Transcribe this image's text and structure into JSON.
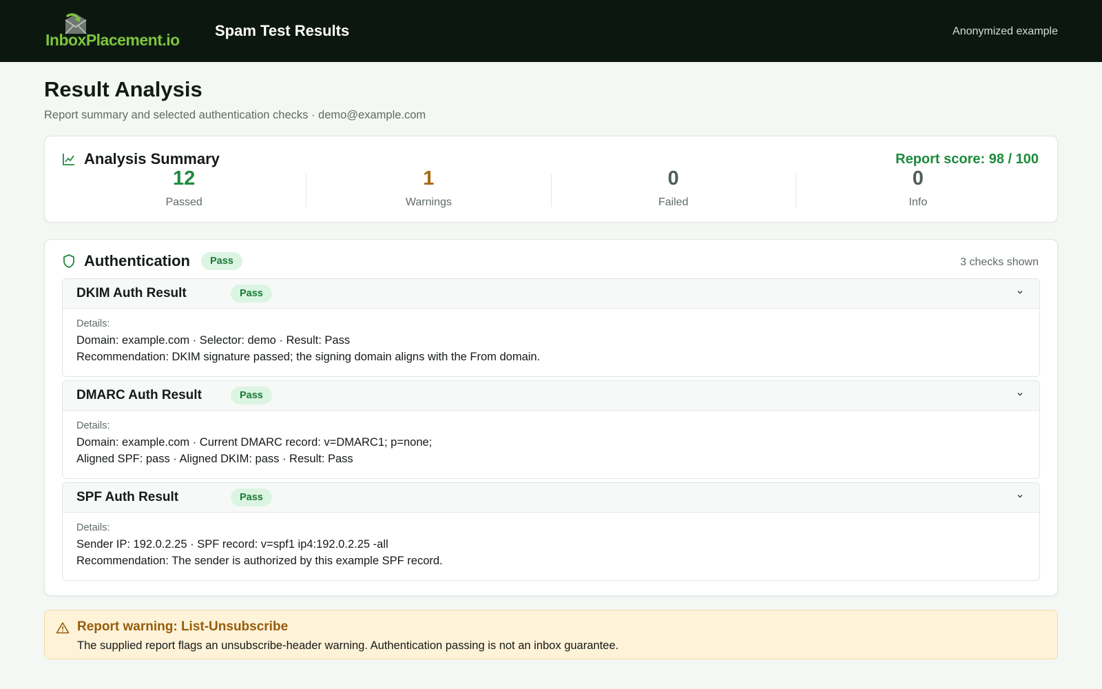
{
  "header": {
    "logo_text": "InboxPlacement.io",
    "app_title": "Spam Test Results",
    "anon_label": "Anonymized example"
  },
  "page": {
    "title": "Result Analysis",
    "subtitle": "Report summary and selected authentication checks · demo@example.com"
  },
  "summary": {
    "title": "Analysis Summary",
    "score": "Report score: 98 / 100",
    "icon": "chart-line-icon",
    "stats": [
      {
        "value": "12",
        "label": "Passed",
        "color": "#1d8a3c"
      },
      {
        "value": "1",
        "label": "Warnings",
        "color": "#a8680f"
      },
      {
        "value": "0",
        "label": "Failed",
        "color": "#4f5e56"
      },
      {
        "value": "0",
        "label": "Info",
        "color": "#4f5e56"
      }
    ]
  },
  "authentication": {
    "title": "Authentication",
    "badge": "Pass",
    "icon": "shield-icon",
    "checks_count": "3 checks shown",
    "checks": [
      {
        "name": "DKIM Auth Result",
        "badge": "Pass",
        "details_label": "Details:",
        "line1": "Domain: example.com · Selector: demo · Result: Pass",
        "line2": "Recommendation: DKIM signature passed; the signing domain aligns with the From domain."
      },
      {
        "name": "DMARC Auth Result",
        "badge": "Pass",
        "details_label": "Details:",
        "line1": "Domain: example.com · Current DMARC record: v=DMARC1; p=none;",
        "line2": "Aligned SPF: pass · Aligned DKIM: pass · Result: Pass"
      },
      {
        "name": "SPF Auth Result",
        "badge": "Pass",
        "details_label": "Details:",
        "line1": "Sender IP: 192.0.2.25 · SPF record: v=spf1 ip4:192.0.2.25 -all",
        "line2": "Recommendation: The sender is authorized by this example SPF record."
      }
    ]
  },
  "warning": {
    "title": "Report warning: List-Unsubscribe",
    "text": "The supplied report flags an unsubscribe-header warning. Authentication passing is not an inbox guarantee.",
    "icon": "warning-triangle-icon"
  },
  "colors": {
    "header_bg": "#0c180f",
    "brand_green": "#7dc43f",
    "pass_green": "#1d8a3c",
    "warning_amber": "#955d0b"
  }
}
